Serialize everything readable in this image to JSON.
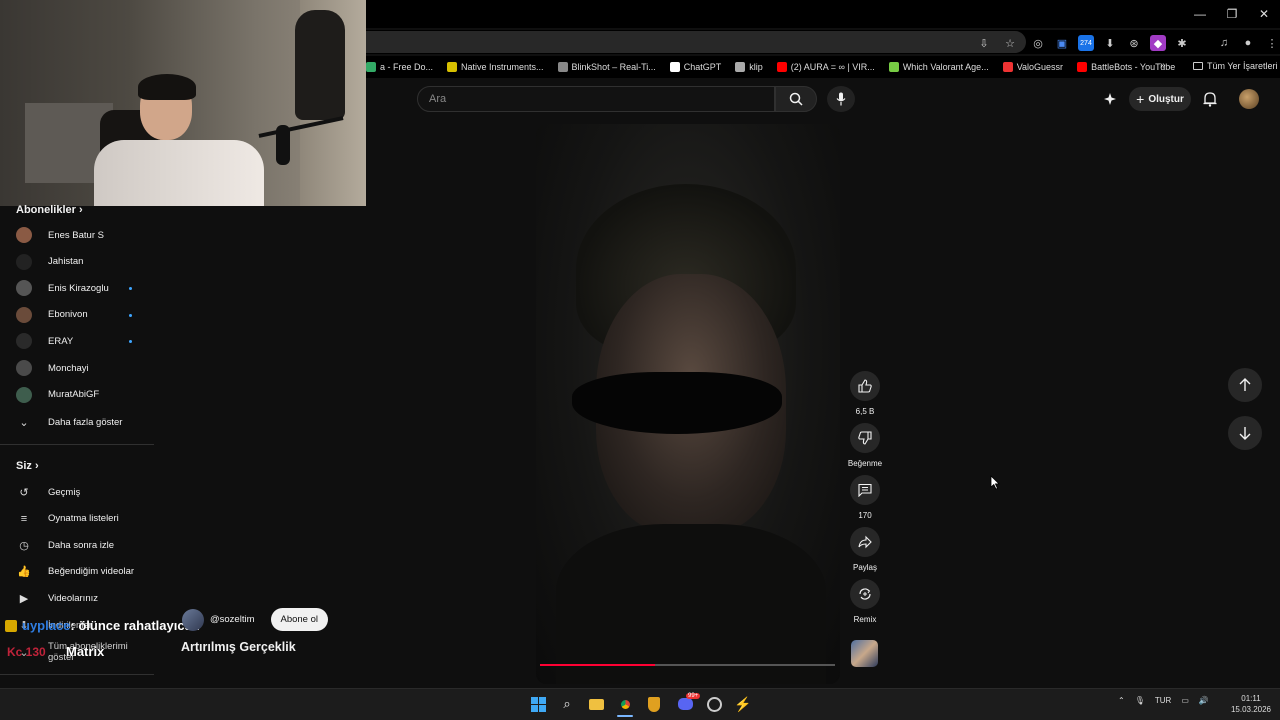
{
  "browser": {
    "window_controls": [
      "—",
      "❐",
      "✕"
    ],
    "bookmarks": [
      {
        "label": "a - Free Do...",
        "color": "#3a6"
      },
      {
        "label": "Native Instruments...",
        "color": "#d7c000"
      },
      {
        "label": "BlinkShot – Real-Ti...",
        "color": "#888"
      },
      {
        "label": "ChatGPT",
        "color": "#fff"
      },
      {
        "label": "klip",
        "color": "#aaa"
      },
      {
        "label": "(2) AURA = ∞ | VIR...",
        "color": "#f00"
      },
      {
        "label": "Which Valorant Age...",
        "color": "#7c4"
      },
      {
        "label": "ValoGuessr",
        "color": "#e33"
      },
      {
        "label": "BattleBots - YouTube",
        "color": "#f00"
      }
    ],
    "all_bookmarks_label": "Tüm Yer İşaretleri",
    "extension_badge": "274"
  },
  "header": {
    "search_placeholder": "Ara",
    "create_label": "Oluştur"
  },
  "sidebar": {
    "subscriptions_title": "Abonelikler",
    "subscriptions": [
      {
        "label": "Enes Batur S",
        "dot": false,
        "color": "#8a5a44"
      },
      {
        "label": "Jahistan",
        "dot": false,
        "color": "#222"
      },
      {
        "label": "Enis Kirazoglu",
        "dot": true,
        "color": "#555"
      },
      {
        "label": "Ebonivon",
        "dot": true,
        "color": "#6a4b3a"
      },
      {
        "label": "ERAY",
        "dot": true,
        "color": "#2a2a2a"
      },
      {
        "label": "Monchayi",
        "dot": false,
        "color": "#4a4a4a"
      },
      {
        "label": "MuratAbiGF",
        "dot": false,
        "color": "#3e5d4d"
      }
    ],
    "show_more": "Daha fazla göster",
    "you_title": "Siz",
    "you_items": [
      {
        "label": "Geçmiş",
        "icon": "history-icon",
        "glyph": "↺"
      },
      {
        "label": "Oynatma listeleri",
        "icon": "playlists-icon",
        "glyph": "≡"
      },
      {
        "label": "Daha sonra izle",
        "icon": "watch-later-icon",
        "glyph": "◷"
      },
      {
        "label": "Beğendiğim videolar",
        "icon": "liked-icon",
        "glyph": "👍"
      },
      {
        "label": "Videolarınız",
        "icon": "your-videos-icon",
        "glyph": "▶"
      }
    ],
    "hidden_items": [
      "İndirilenler",
      "Tüm aboneliklerimi göster"
    ]
  },
  "stream_overlay": {
    "line1_prefix": "uyplace",
    "line1_suffix": ": ölünce rahatlayıcsn",
    "line2_live": "Kc 130",
    "line2": "Matrix"
  },
  "short": {
    "channel": "@sozeltim",
    "subscribe_label": "Abone ol",
    "title": "Artırılmış Gerçeklik",
    "progress": 0.39,
    "actions": {
      "like_count": "6,5 B",
      "dislike_label": "Beğenme",
      "comment_count": "170",
      "share_label": "Paylaş",
      "remix_label": "Remix"
    }
  },
  "taskbar": {
    "language": "TUR",
    "time": "01:11",
    "date": "15.03.2026",
    "discord_badge": "99+"
  }
}
